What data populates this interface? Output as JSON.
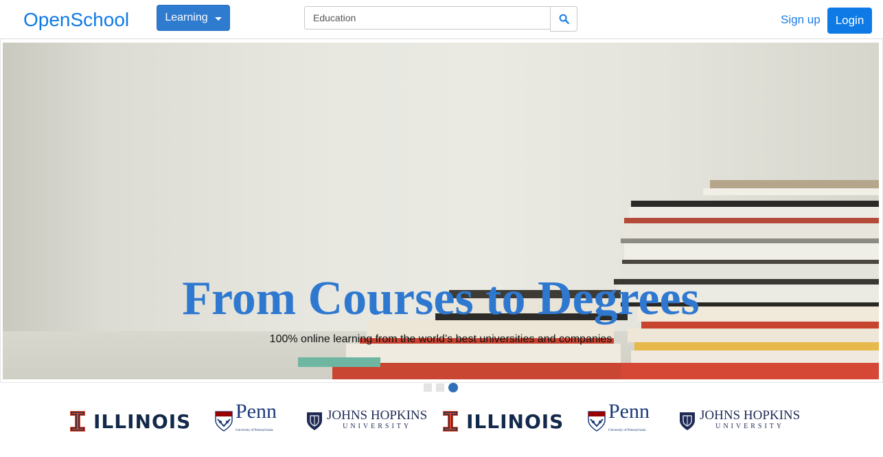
{
  "navbar": {
    "brand": "OpenSchool",
    "learning_label": "Learning",
    "search_placeholder": "Education",
    "search_value": "",
    "signup_label": "Sign up",
    "login_label": "Login"
  },
  "hero": {
    "title": "From Courses to Degrees",
    "subtitle": "100% online learning from the world’s best universities and companies",
    "slide_count": 3,
    "active_slide": 3
  },
  "partners": [
    {
      "name": "ILLINOIS"
    },
    {
      "name": "Penn",
      "sub": "University of Pennsylvania"
    },
    {
      "name_top": "JOHNS HOPKINS",
      "name_bottom": "UNIVERSITY"
    },
    {
      "name": "ILLINOIS"
    },
    {
      "name": "Penn",
      "sub": "University of Pennsylvania"
    },
    {
      "name_top": "JOHNS HOPKINS",
      "name_bottom": "UNIVERSITY"
    }
  ],
  "colors": {
    "brand": "#0d7ae6",
    "learning_button": "#2f7bd0",
    "hero_title": "#2f78d0",
    "indicator_active": "#2f6fb8"
  },
  "icons": {
    "search": "search-icon",
    "caret": "caret-down-icon"
  }
}
